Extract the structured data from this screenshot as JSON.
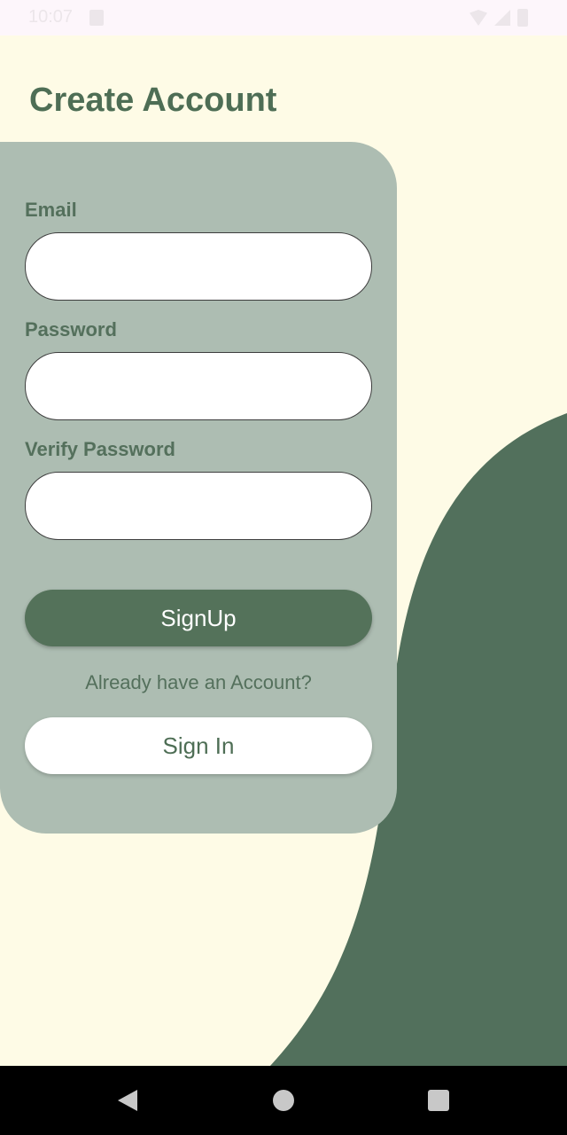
{
  "status_bar": {
    "time": "10:07"
  },
  "page": {
    "title": "Create Account"
  },
  "form": {
    "email_label": "Email",
    "email_value": "",
    "password_label": "Password",
    "password_value": "",
    "verify_label": "Verify Password",
    "verify_value": "",
    "signup_label": "SignUp",
    "helper_text": "Already have an Account?",
    "signin_label": "Sign In"
  },
  "colors": {
    "background": "#fefbe6",
    "accent": "#54725a",
    "card": "#adbdb2",
    "title": "#4e6e55"
  },
  "nav_bar": {
    "icons": [
      "back-icon",
      "home-icon",
      "recents-icon"
    ]
  }
}
